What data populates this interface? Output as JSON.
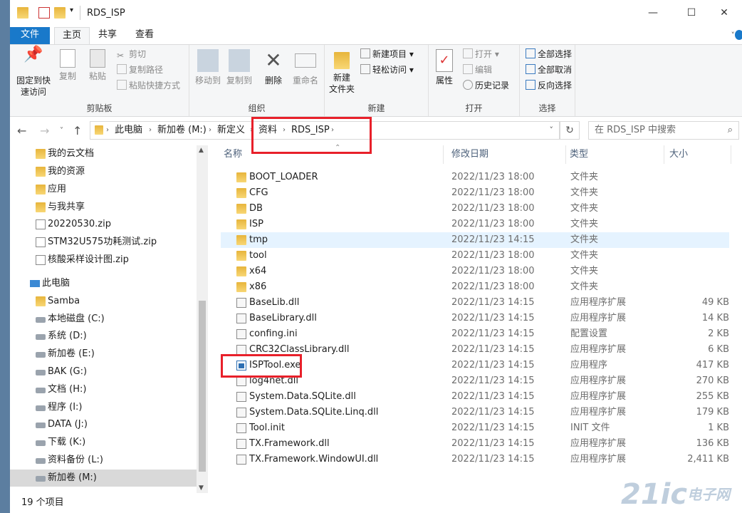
{
  "window": {
    "title": "RDS_ISP",
    "minimize": "—",
    "maximize": "☐",
    "close": "✕"
  },
  "tabs": {
    "file": "文件",
    "home": "主页",
    "share": "共享",
    "view": "查看"
  },
  "ribbon": {
    "clipboard": {
      "label": "剪贴板",
      "pin": "固定到快\n速访问",
      "copy": "复制",
      "paste": "粘贴",
      "cut": "剪切",
      "copy_path": "复制路径",
      "paste_shortcut": "粘贴快捷方式"
    },
    "organize": {
      "label": "组织",
      "move_to": "移动到",
      "copy_to": "复制到",
      "delete": "删除",
      "rename": "重命名"
    },
    "new": {
      "label": "新建",
      "new_folder": "新建\n文件夹",
      "new_item": "新建项目",
      "easy_access": "轻松访问"
    },
    "open": {
      "label": "打开",
      "properties": "属性",
      "open": "打开",
      "edit": "编辑",
      "history": "历史记录"
    },
    "select": {
      "label": "选择",
      "select_all": "全部选择",
      "select_none": "全部取消",
      "invert": "反向选择"
    }
  },
  "address": {
    "crumbs": [
      "此电脑",
      "新加卷 (M:)",
      "新定义",
      "资料",
      "RDS_ISP"
    ],
    "search_placeholder": "在 RDS_ISP 中搜索"
  },
  "nav": [
    {
      "label": "我的云文档",
      "icon": "folder-icon"
    },
    {
      "label": "我的资源",
      "icon": "folder-icon"
    },
    {
      "label": "应用",
      "icon": "apps-folder-icon"
    },
    {
      "label": "与我共享",
      "icon": "folder-icon"
    },
    {
      "label": "20220530.zip",
      "icon": "file-icon"
    },
    {
      "label": "STM32U575功耗测试.zip",
      "icon": "file-icon"
    },
    {
      "label": "核酸采样设计图.zip",
      "icon": "file-icon"
    },
    {
      "label": "此电脑",
      "icon": "computer-icon"
    },
    {
      "label": "Samba",
      "icon": "network-folder-icon"
    },
    {
      "label": "本地磁盘 (C:)",
      "icon": "drive-icon"
    },
    {
      "label": "系统 (D:)",
      "icon": "drive-icon"
    },
    {
      "label": "新加卷 (E:)",
      "icon": "drive-icon"
    },
    {
      "label": "BAK (G:)",
      "icon": "drive-icon"
    },
    {
      "label": "文档 (H:)",
      "icon": "drive-icon"
    },
    {
      "label": "程序 (I:)",
      "icon": "drive-icon"
    },
    {
      "label": "DATA (J:)",
      "icon": "drive-icon"
    },
    {
      "label": "下载 (K:)",
      "icon": "drive-icon"
    },
    {
      "label": "资料备份 (L:)",
      "icon": "drive-icon"
    },
    {
      "label": "新加卷 (M:)",
      "icon": "drive-icon"
    }
  ],
  "columns": {
    "name": "名称",
    "date": "修改日期",
    "type": "类型",
    "size": "大小"
  },
  "files": [
    {
      "name": "BOOT_LOADER",
      "date": "2022/11/23 18:00",
      "type": "文件夹",
      "size": "",
      "kind": "folder"
    },
    {
      "name": "CFG",
      "date": "2022/11/23 18:00",
      "type": "文件夹",
      "size": "",
      "kind": "folder"
    },
    {
      "name": "DB",
      "date": "2022/11/23 18:00",
      "type": "文件夹",
      "size": "",
      "kind": "folder"
    },
    {
      "name": "ISP",
      "date": "2022/11/23 18:00",
      "type": "文件夹",
      "size": "",
      "kind": "folder"
    },
    {
      "name": "tmp",
      "date": "2022/11/23 14:15",
      "type": "文件夹",
      "size": "",
      "kind": "folder"
    },
    {
      "name": "tool",
      "date": "2022/11/23 18:00",
      "type": "文件夹",
      "size": "",
      "kind": "folder"
    },
    {
      "name": "x64",
      "date": "2022/11/23 18:00",
      "type": "文件夹",
      "size": "",
      "kind": "folder"
    },
    {
      "name": "x86",
      "date": "2022/11/23 18:00",
      "type": "文件夹",
      "size": "",
      "kind": "folder"
    },
    {
      "name": "BaseLib.dll",
      "date": "2022/11/23 14:15",
      "type": "应用程序扩展",
      "size": "49 KB",
      "kind": "dll"
    },
    {
      "name": "BaseLibrary.dll",
      "date": "2022/11/23 14:15",
      "type": "应用程序扩展",
      "size": "14 KB",
      "kind": "dll"
    },
    {
      "name": "confing.ini",
      "date": "2022/11/23 14:15",
      "type": "配置设置",
      "size": "2 KB",
      "kind": "dll"
    },
    {
      "name": "CRC32ClassLibrary.dll",
      "date": "2022/11/23 14:15",
      "type": "应用程序扩展",
      "size": "6 KB",
      "kind": "dll"
    },
    {
      "name": "ISPTool.exe",
      "date": "2022/11/23 14:15",
      "type": "应用程序",
      "size": "417 KB",
      "kind": "exe"
    },
    {
      "name": "log4net.dll",
      "date": "2022/11/23 14:15",
      "type": "应用程序扩展",
      "size": "270 KB",
      "kind": "dll"
    },
    {
      "name": "System.Data.SQLite.dll",
      "date": "2022/11/23 14:15",
      "type": "应用程序扩展",
      "size": "255 KB",
      "kind": "dll"
    },
    {
      "name": "System.Data.SQLite.Linq.dll",
      "date": "2022/11/23 14:15",
      "type": "应用程序扩展",
      "size": "179 KB",
      "kind": "dll"
    },
    {
      "name": "Tool.init",
      "date": "2022/11/23 14:15",
      "type": "INIT 文件",
      "size": "1 KB",
      "kind": "dll"
    },
    {
      "name": "TX.Framework.dll",
      "date": "2022/11/23 14:15",
      "type": "应用程序扩展",
      "size": "136 KB",
      "kind": "dll"
    },
    {
      "name": "TX.Framework.WindowUI.dll",
      "date": "2022/11/23 14:15",
      "type": "应用程序扩展",
      "size": "2,411 KB",
      "kind": "dll"
    }
  ],
  "status": {
    "count": "19 个项目"
  },
  "watermark": {
    "main": "21ic",
    "sub": "电子网"
  }
}
